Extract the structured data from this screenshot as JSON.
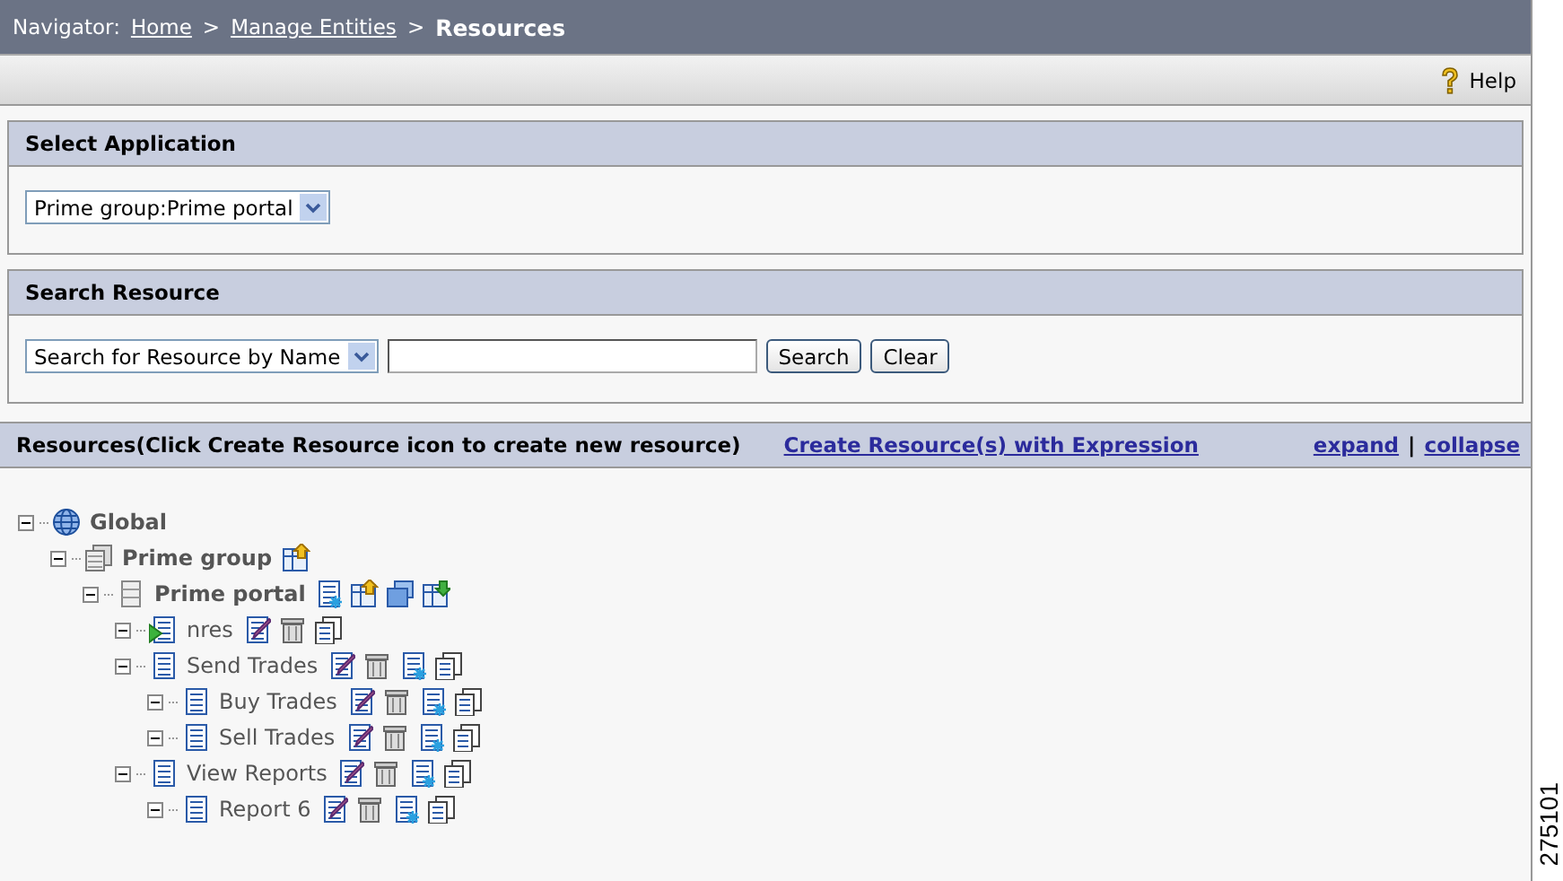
{
  "navigator": {
    "label": "Navigator:",
    "links": [
      "Home",
      "Manage Entities"
    ],
    "separators": [
      ">",
      ">"
    ],
    "current": "Resources"
  },
  "toolbar": {
    "help": "Help"
  },
  "select_application": {
    "title": "Select Application",
    "dropdown": {
      "value": "Prime group:Prime portal"
    }
  },
  "search_resource": {
    "title": "Search Resource",
    "dropdown": {
      "value": "Search for Resource by Name"
    },
    "buttons": [
      "Search",
      "Clear"
    ]
  },
  "resources": {
    "title": "Resources(Click Create Resource icon to create new resource)",
    "expression_link": "Create Resource(s) with Expression",
    "expand": "expand",
    "separator": "|",
    "collapse": "collapse",
    "tree": [
      {
        "label": "Global",
        "kind": "globe",
        "bold": true,
        "expanded": true,
        "children": [
          {
            "label": "Prime group",
            "kind": "group",
            "bold": true,
            "expanded": true,
            "actions": [
              {
                "kind": "import"
              }
            ],
            "children": [
              {
                "label": "Prime portal",
                "kind": "portal",
                "bold": true,
                "expanded": true,
                "actions": [
                  {
                    "kind": "create"
                  },
                  {
                    "kind": "import"
                  },
                  {
                    "kind": "folder"
                  },
                  {
                    "kind": "export"
                  }
                ],
                "children": [
                  {
                    "label": "nres",
                    "kind": "resource-play",
                    "bold": false,
                    "expanded": true,
                    "actions": [
                      {
                        "kind": "edit"
                      },
                      {
                        "kind": "delete"
                      },
                      {
                        "kind": "copy"
                      }
                    ]
                  },
                  {
                    "label": "Send Trades",
                    "kind": "resource",
                    "bold": false,
                    "expanded": true,
                    "actions": [
                      {
                        "kind": "edit"
                      },
                      {
                        "kind": "delete"
                      },
                      {
                        "kind": "create"
                      },
                      {
                        "kind": "copy"
                      }
                    ],
                    "children": [
                      {
                        "label": "Buy Trades",
                        "kind": "resource",
                        "bold": false,
                        "expanded": true,
                        "actions": [
                          {
                            "kind": "edit"
                          },
                          {
                            "kind": "delete"
                          },
                          {
                            "kind": "create"
                          },
                          {
                            "kind": "copy"
                          }
                        ]
                      },
                      {
                        "label": "Sell Trades",
                        "kind": "resource",
                        "bold": false,
                        "expanded": true,
                        "actions": [
                          {
                            "kind": "edit"
                          },
                          {
                            "kind": "delete"
                          },
                          {
                            "kind": "create"
                          },
                          {
                            "kind": "copy"
                          }
                        ]
                      }
                    ]
                  },
                  {
                    "label": "View Reports",
                    "kind": "resource",
                    "bold": false,
                    "expanded": true,
                    "actions": [
                      {
                        "kind": "edit"
                      },
                      {
                        "kind": "delete"
                      },
                      {
                        "kind": "create"
                      },
                      {
                        "kind": "copy"
                      }
                    ],
                    "children": [
                      {
                        "label": "Report 6",
                        "kind": "resource",
                        "bold": false,
                        "expanded": true,
                        "actions": [
                          {
                            "kind": "edit"
                          },
                          {
                            "kind": "delete"
                          },
                          {
                            "kind": "create"
                          },
                          {
                            "kind": "copy"
                          }
                        ]
                      }
                    ]
                  }
                ]
              }
            ]
          }
        ]
      }
    ]
  },
  "figure_number": "275101"
}
